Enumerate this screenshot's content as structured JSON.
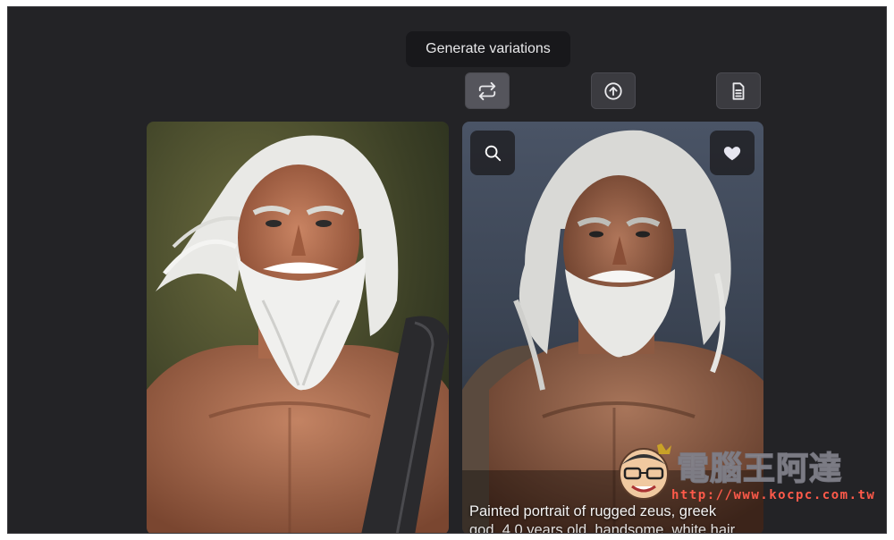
{
  "tooltip": {
    "text": "Generate variations"
  },
  "toolbar": {
    "buttons": [
      {
        "name": "generate-variations-button",
        "icon": "repeat-arrows-icon"
      },
      {
        "name": "upload-button",
        "icon": "arrow-up-circle-icon"
      },
      {
        "name": "document-button",
        "icon": "document-icon"
      }
    ]
  },
  "cards": [
    {
      "name": "portrait-card-1",
      "alt": "Painted portrait of rugged zeus with white hair and beard"
    },
    {
      "name": "portrait-card-2",
      "overlay_left_icon": "search-icon",
      "overlay_right_icon": "heart-icon",
      "caption_line1": "Painted portrait of rugged zeus, greek",
      "caption_line2": "god, 4 0 years old, handsome, white hair"
    }
  ],
  "watermark": {
    "title": "電腦王阿達",
    "url": "http://www.kocpc.com.tw"
  },
  "colors": {
    "background": "#232326",
    "button": "#3b3b40",
    "button_active": "#55555c",
    "tooltip": "#18181b"
  }
}
